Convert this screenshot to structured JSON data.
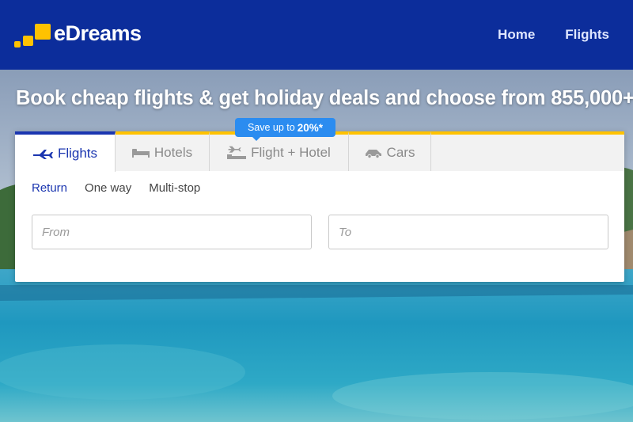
{
  "header": {
    "brand": "eDreams",
    "nav": [
      {
        "label": "Home"
      },
      {
        "label": "Flights"
      }
    ]
  },
  "headline": "Book cheap flights & get holiday deals and choose from 855,000+",
  "search": {
    "tabs": [
      {
        "label": "Flights",
        "icon": "plane-icon",
        "active": true
      },
      {
        "label": "Hotels",
        "icon": "bed-icon",
        "active": false
      },
      {
        "label": "Flight + Hotel",
        "icon": "flight-hotel-icon",
        "active": false
      },
      {
        "label": "Cars",
        "icon": "car-icon",
        "active": false
      }
    ],
    "promo_badge": {
      "text": "Save up to",
      "value": "20%*"
    },
    "trip_types": [
      {
        "label": "Return",
        "selected": true
      },
      {
        "label": "One way",
        "selected": false
      },
      {
        "label": "Multi-stop",
        "selected": false
      }
    ],
    "from": {
      "placeholder": "From",
      "value": ""
    },
    "to": {
      "placeholder": "To",
      "value": ""
    }
  },
  "colors": {
    "header_bg": "#0c2d9b",
    "brand_yellow": "#ffc200",
    "active_blue": "#1b36b0",
    "badge_blue": "#2b8cf0"
  }
}
